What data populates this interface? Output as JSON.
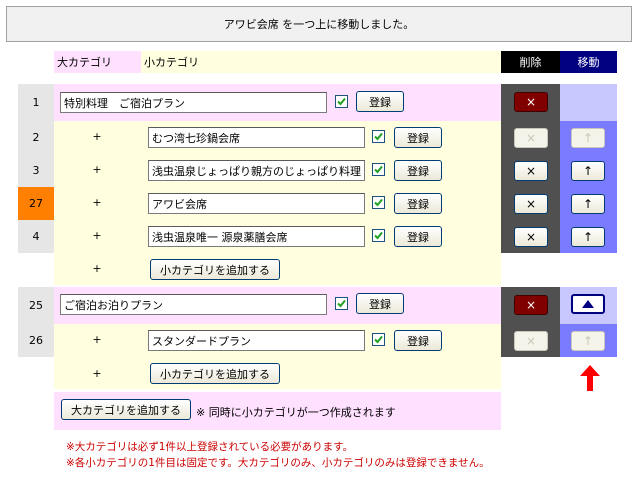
{
  "message": "アワビ会席 を一つ上に移動しました。",
  "headers": {
    "large": "大カテゴリ",
    "small": "小カテゴリ",
    "delete": "削除",
    "move": "移動"
  },
  "register_label": "登録",
  "add_small_label": "小カテゴリを追加する",
  "plus_sign": "+",
  "delete_symbol": "×",
  "up_symbol": "↑",
  "groups": [
    {
      "id": "1",
      "name": "特別料理　ご宿泊プラン",
      "checked": true,
      "items": [
        {
          "id": "2",
          "name": "むつ湾七珍鍋会席",
          "checked": true,
          "highlight": false,
          "delete_enabled": false,
          "move_enabled": false
        },
        {
          "id": "3",
          "name": "浅虫温泉じょっぱり親方のじょっぱり料理",
          "checked": true,
          "highlight": false,
          "delete_enabled": true,
          "move_enabled": true
        },
        {
          "id": "27",
          "name": "アワビ会席",
          "checked": true,
          "highlight": true,
          "delete_enabled": true,
          "move_enabled": true
        },
        {
          "id": "4",
          "name": "浅虫温泉唯一 源泉薬膳会席",
          "checked": true,
          "highlight": false,
          "delete_enabled": true,
          "move_enabled": true
        }
      ]
    },
    {
      "id": "25",
      "name": "ご宿泊お泊りプラン",
      "checked": true,
      "items": [
        {
          "id": "26",
          "name": "スタンダードプラン",
          "checked": true,
          "highlight": false,
          "delete_enabled": false,
          "move_enabled": false
        }
      ]
    }
  ],
  "footer": {
    "add_large_label": "大カテゴリを追加する",
    "add_large_note": "※ 同時に小カテゴリが一つ作成されます",
    "notes": [
      "※大カテゴリは必ず1件以上登録されている必要があります。",
      "※各小カテゴリの1件目は固定です。大カテゴリのみ、小カテゴリのみは登録できません。"
    ]
  },
  "colors": {
    "accent_arrow": "#ff0000",
    "delete_active": "#800000",
    "move_header": "#000080"
  }
}
